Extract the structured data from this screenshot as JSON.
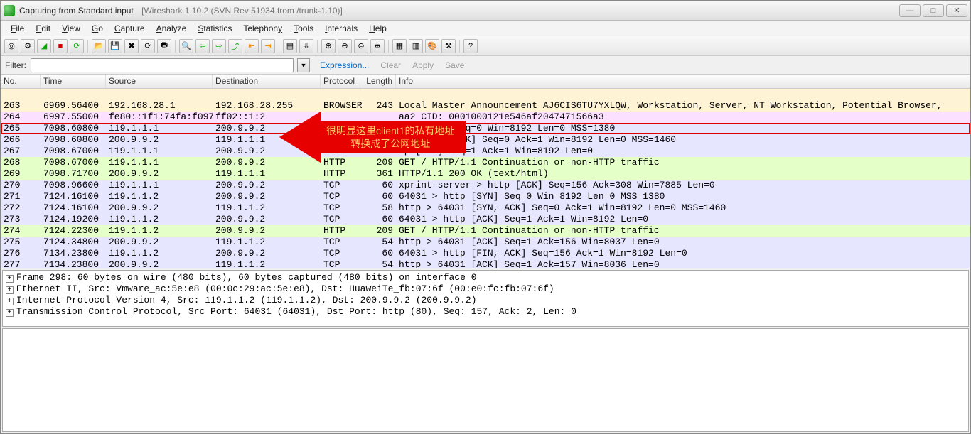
{
  "window": {
    "title_main": "Capturing from Standard input",
    "title_sub": "[Wireshark 1.10.2  (SVN Rev 51934 from /trunk-1.10)]"
  },
  "menu": {
    "file": "File",
    "edit": "Edit",
    "view": "View",
    "go": "Go",
    "capture": "Capture",
    "analyze": "Analyze",
    "statistics": "Statistics",
    "telephony": "Telephony",
    "tools": "Tools",
    "internals": "Internals",
    "help": "Help"
  },
  "filter": {
    "label": "Filter:",
    "value": "",
    "expression": "Expression...",
    "clear": "Clear",
    "apply": "Apply",
    "save": "Save"
  },
  "columns": {
    "no": "No.",
    "time": "Time",
    "source": "Source",
    "destination": "Destination",
    "protocol": "Protocol",
    "length": "Length",
    "info": "Info"
  },
  "packets": [
    {
      "no": "",
      "time": "",
      "src": "",
      "dst": "",
      "proto": "",
      "len": "",
      "info": "",
      "cls": "browser"
    },
    {
      "no": "263",
      "time": "6969.56400",
      "src": "192.168.28.1",
      "dst": "192.168.28.255",
      "proto": "BROWSER",
      "len": "243",
      "info": "Local Master Announcement AJ6CIS6TU7YXLQW, Workstation, Server, NT Workstation, Potential Browser,",
      "cls": "browser"
    },
    {
      "no": "264",
      "time": "6997.55000",
      "src": "fe80::1f1:74fa:f097",
      "dst": "ff02::1:2",
      "proto": "",
      "len": "",
      "info": "aa2 CID: 0001000121e546af2047471566a3",
      "cls": "icmpv6"
    },
    {
      "no": "265",
      "time": "7098.60800",
      "src": "119.1.1.1",
      "dst": "200.9.9.2",
      "proto": "",
      "len": "",
      "info": "ttp [SYN] Seq=0 Win=8192 Len=0 MSS=1380",
      "cls": "tcp",
      "hl": true
    },
    {
      "no": "266",
      "time": "7098.60800",
      "src": "200.9.9.2",
      "dst": "119.1.1.1",
      "proto": "",
      "len": "",
      "info": "ver [SYN, ACK] Seq=0 Ack=1 Win=8192 Len=0 MSS=1460",
      "cls": "tcp"
    },
    {
      "no": "267",
      "time": "7098.67000",
      "src": "119.1.1.1",
      "dst": "200.9.9.2",
      "proto": "",
      "len": "",
      "info": "tp [ACK] Seq=1 Ack=1 Win=8192 Len=0",
      "cls": "tcp"
    },
    {
      "no": "268",
      "time": "7098.67000",
      "src": "119.1.1.1",
      "dst": "200.9.9.2",
      "proto": "HTTP",
      "len": "209",
      "info": "GET / HTTP/1.1 Continuation or non-HTTP traffic",
      "cls": "http"
    },
    {
      "no": "269",
      "time": "7098.71700",
      "src": "200.9.9.2",
      "dst": "119.1.1.1",
      "proto": "HTTP",
      "len": "361",
      "info": "HTTP/1.1 200 OK  (text/html)",
      "cls": "http"
    },
    {
      "no": "270",
      "time": "7098.96600",
      "src": "119.1.1.1",
      "dst": "200.9.9.2",
      "proto": "TCP",
      "len": "60",
      "info": "xprint-server > http [ACK] Seq=156 Ack=308 Win=7885 Len=0",
      "cls": "tcp"
    },
    {
      "no": "271",
      "time": "7124.16100",
      "src": "119.1.1.2",
      "dst": "200.9.9.2",
      "proto": "TCP",
      "len": "60",
      "info": "64031 > http [SYN] Seq=0 Win=8192 Len=0 MSS=1380",
      "cls": "tcp"
    },
    {
      "no": "272",
      "time": "7124.16100",
      "src": "200.9.9.2",
      "dst": "119.1.1.2",
      "proto": "TCP",
      "len": "58",
      "info": "http > 64031 [SYN, ACK] Seq=0 Ack=1 Win=8192 Len=0 MSS=1460",
      "cls": "tcp"
    },
    {
      "no": "273",
      "time": "7124.19200",
      "src": "119.1.1.2",
      "dst": "200.9.9.2",
      "proto": "TCP",
      "len": "60",
      "info": "64031 > http [ACK] Seq=1 Ack=1 Win=8192 Len=0",
      "cls": "tcp"
    },
    {
      "no": "274",
      "time": "7124.22300",
      "src": "119.1.1.2",
      "dst": "200.9.9.2",
      "proto": "HTTP",
      "len": "209",
      "info": "GET / HTTP/1.1 Continuation or non-HTTP traffic",
      "cls": "http"
    },
    {
      "no": "275",
      "time": "7124.34800",
      "src": "200.9.9.2",
      "dst": "119.1.1.2",
      "proto": "TCP",
      "len": "54",
      "info": "http > 64031 [ACK] Seq=1 Ack=156 Win=8037 Len=0",
      "cls": "tcp"
    },
    {
      "no": "276",
      "time": "7134.23800",
      "src": "119.1.1.2",
      "dst": "200.9.9.2",
      "proto": "TCP",
      "len": "60",
      "info": "64031 > http [FIN, ACK] Seq=156 Ack=1 Win=8192 Len=0",
      "cls": "tcp"
    },
    {
      "no": "277",
      "time": "7134.23800",
      "src": "200.9.9.2",
      "dst": "119.1.1.2",
      "proto": "TCP",
      "len": "54",
      "info": "http > 64031 [ACK] Seq=1 Ack=157 Win=8036 Len=0",
      "cls": "tcp"
    }
  ],
  "annotation": {
    "line1": "很明显这里client1的私有地址",
    "line2": "转换成了公网地址"
  },
  "details": {
    "l0": "Frame 298: 60 bytes on wire (480 bits), 60 bytes captured (480 bits) on interface 0",
    "l1": "Ethernet II, Src: Vmware_ac:5e:e8 (00:0c:29:ac:5e:e8), Dst: HuaweiTe_fb:07:6f (00:e0:fc:fb:07:6f)",
    "l2": "Internet Protocol Version 4, Src: 119.1.1.2 (119.1.1.2), Dst: 200.9.9.2 (200.9.9.2)",
    "l3": "Transmission Control Protocol, Src Port: 64031 (64031), Dst Port: http (80), Seq: 157, Ack: 2, Len: 0"
  }
}
